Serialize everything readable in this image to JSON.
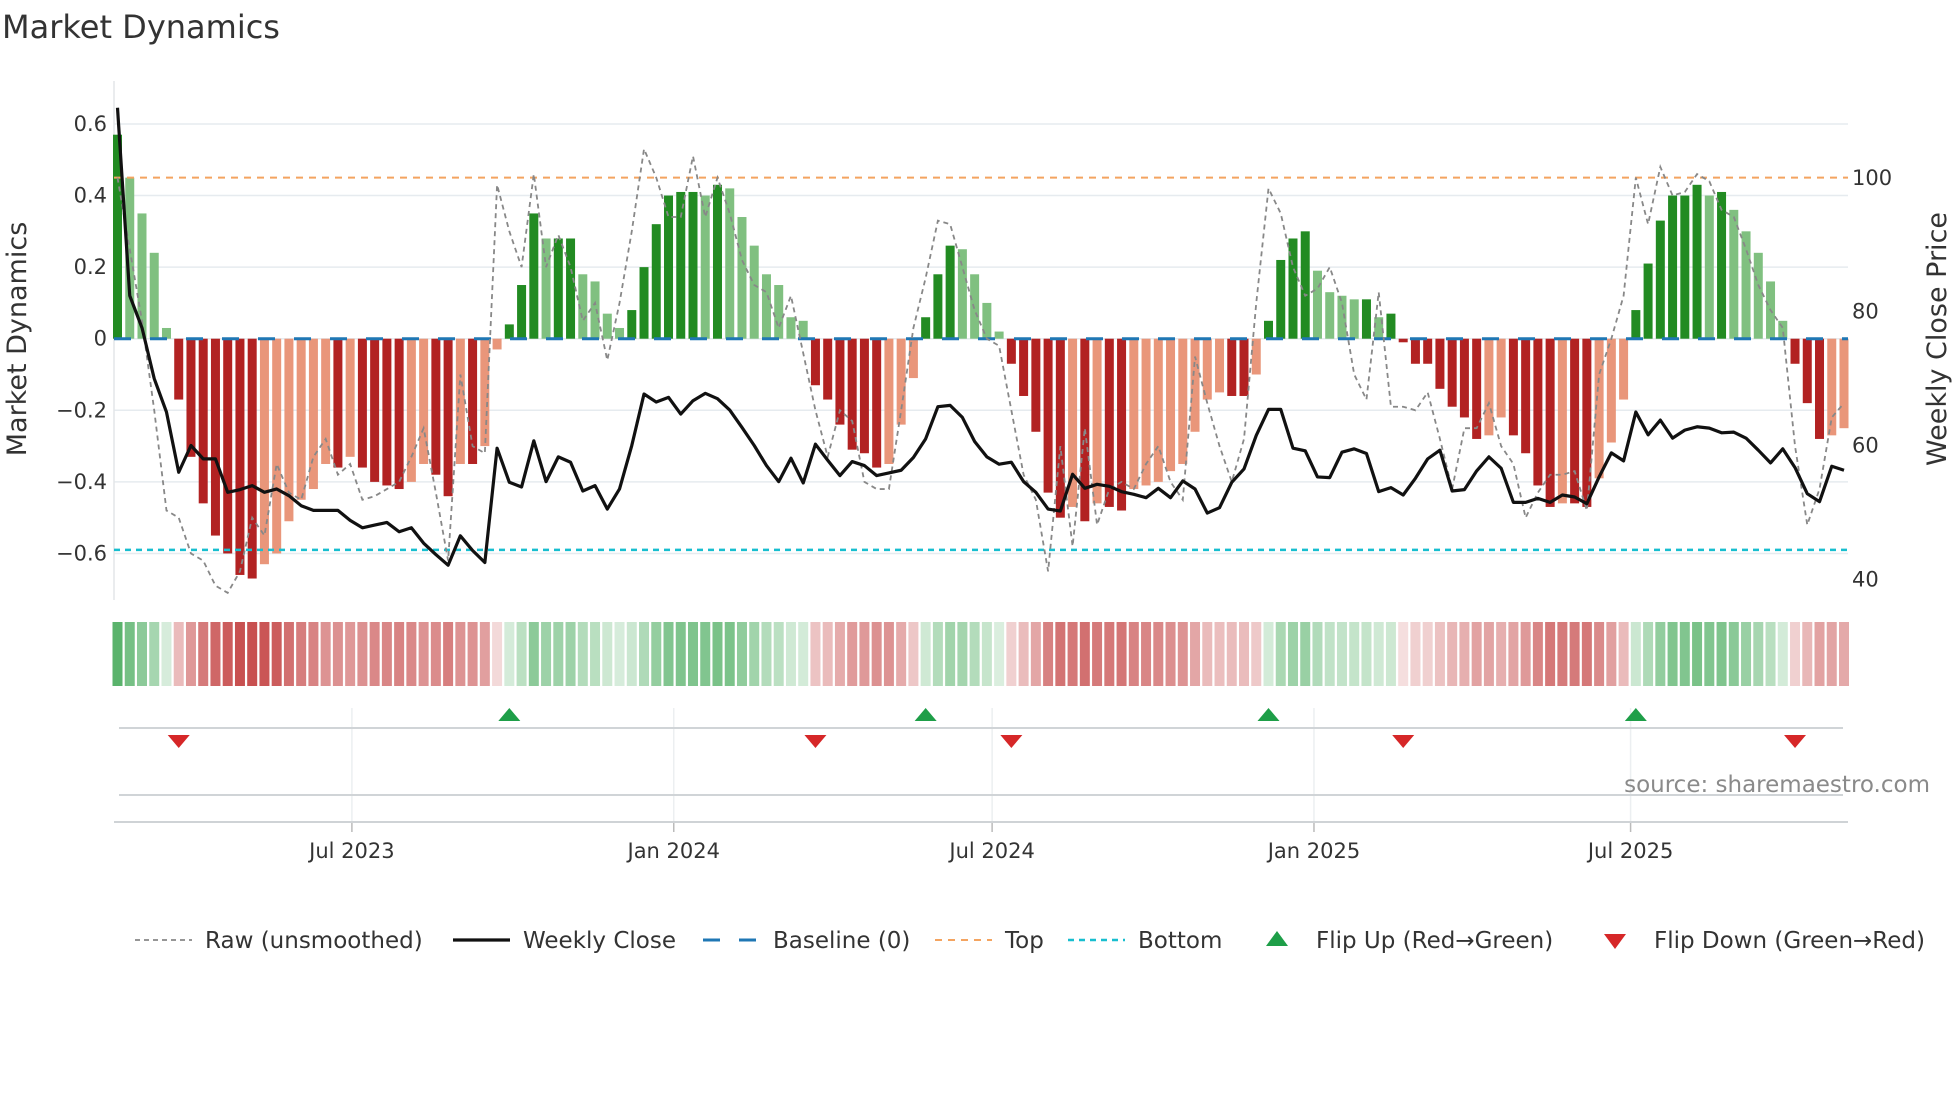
{
  "title": "Market Dynamics",
  "source": "source: sharemaestro.com",
  "chart_data": {
    "type": "bar",
    "title": "Market Dynamics",
    "ylabel": "Market Dynamics",
    "y2label": "Weekly Close Price",
    "ylim": [
      -0.73,
      0.72
    ],
    "y2lim": [
      36.9,
      114.5
    ],
    "start_date": "2023-02-17",
    "frequency": "weekly",
    "yticks": [
      {
        "v": 0.6,
        "label": "0.6"
      },
      {
        "v": 0.4,
        "label": "0.4"
      },
      {
        "v": 0.2,
        "label": "0.2"
      },
      {
        "v": 0,
        "label": "0"
      },
      {
        "v": -0.2,
        "label": "−0.2"
      },
      {
        "v": -0.4,
        "label": "−0.4"
      },
      {
        "v": -0.6,
        "label": "−0.6"
      }
    ],
    "y2ticks": [
      {
        "v": 100,
        "label": "100"
      },
      {
        "v": 80,
        "label": "80"
      },
      {
        "v": 60,
        "label": "60"
      },
      {
        "v": 40,
        "label": "40"
      }
    ],
    "xticks": [
      {
        "date": "2023-07-01",
        "label": "Jul 2023"
      },
      {
        "date": "2024-01-01",
        "label": "Jan 2024"
      },
      {
        "date": "2024-07-01",
        "label": "Jul 2024"
      },
      {
        "date": "2025-01-01",
        "label": "Jan 2025"
      },
      {
        "date": "2025-07-01",
        "label": "Jul 2025"
      }
    ],
    "top_level": 0.45,
    "bottom_level": -0.59,
    "baseline": 0,
    "smoothed": [
      0.57,
      0.45,
      0.35,
      0.24,
      0.03,
      -0.17,
      -0.33,
      -0.46,
      -0.55,
      -0.6,
      -0.66,
      -0.67,
      -0.63,
      -0.6,
      -0.51,
      -0.45,
      -0.42,
      -0.35,
      -0.36,
      -0.33,
      -0.36,
      -0.4,
      -0.41,
      -0.42,
      -0.4,
      -0.35,
      -0.38,
      -0.44,
      -0.35,
      -0.35,
      -0.3,
      -0.03,
      0.04,
      0.15,
      0.35,
      0.28,
      0.28,
      0.28,
      0.18,
      0.16,
      0.07,
      0.03,
      0.08,
      0.2,
      0.32,
      0.4,
      0.41,
      0.41,
      0.4,
      0.43,
      0.42,
      0.34,
      0.26,
      0.18,
      0.15,
      0.06,
      0.05,
      -0.13,
      -0.17,
      -0.24,
      -0.31,
      -0.32,
      -0.36,
      -0.35,
      -0.24,
      -0.11,
      0.06,
      0.18,
      0.26,
      0.25,
      0.18,
      0.1,
      0.02,
      -0.07,
      -0.16,
      -0.26,
      -0.43,
      -0.5,
      -0.47,
      -0.51,
      -0.46,
      -0.47,
      -0.48,
      -0.42,
      -0.41,
      -0.4,
      -0.37,
      -0.35,
      -0.26,
      -0.17,
      -0.15,
      -0.16,
      -0.16,
      -0.1,
      0.05,
      0.22,
      0.28,
      0.3,
      0.19,
      0.13,
      0.12,
      0.11,
      0.11,
      0.06,
      0.07,
      -0.01,
      -0.07,
      -0.07,
      -0.14,
      -0.19,
      -0.22,
      -0.28,
      -0.27,
      -0.22,
      -0.27,
      -0.32,
      -0.41,
      -0.47,
      -0.46,
      -0.46,
      -0.47,
      -0.39,
      -0.29,
      -0.17,
      0.08,
      0.21,
      0.33,
      0.4,
      0.4,
      0.43,
      0.4,
      0.41,
      0.36,
      0.3,
      0.24,
      0.16,
      0.05,
      -0.07,
      -0.18,
      -0.28,
      -0.27,
      -0.25
    ],
    "raw": [
      0.45,
      0.25,
      0.05,
      -0.2,
      -0.48,
      -0.5,
      -0.6,
      -0.62,
      -0.69,
      -0.71,
      -0.65,
      -0.5,
      -0.55,
      -0.35,
      -0.43,
      -0.45,
      -0.33,
      -0.28,
      -0.38,
      -0.35,
      -0.45,
      -0.44,
      -0.42,
      -0.4,
      -0.33,
      -0.25,
      -0.43,
      -0.62,
      -0.1,
      -0.3,
      -0.32,
      0.43,
      0.3,
      0.2,
      0.46,
      0.2,
      0.29,
      0.2,
      0.05,
      0.1,
      -0.06,
      0.1,
      0.3,
      0.53,
      0.45,
      0.34,
      0.34,
      0.51,
      0.34,
      0.45,
      0.35,
      0.22,
      0.15,
      0.13,
      0.03,
      0.12,
      -0.04,
      -0.2,
      -0.33,
      -0.2,
      -0.23,
      -0.4,
      -0.42,
      -0.42,
      -0.2,
      0.03,
      0.17,
      0.33,
      0.32,
      0.2,
      0.08,
      0.0,
      -0.02,
      -0.2,
      -0.38,
      -0.45,
      -0.65,
      -0.3,
      -0.58,
      -0.25,
      -0.52,
      -0.42,
      -0.4,
      -0.42,
      -0.35,
      -0.3,
      -0.4,
      -0.45,
      -0.05,
      -0.18,
      -0.3,
      -0.4,
      -0.28,
      0.1,
      0.42,
      0.35,
      0.2,
      0.12,
      0.14,
      0.2,
      0.1,
      -0.1,
      -0.17,
      0.13,
      -0.19,
      -0.19,
      -0.2,
      -0.15,
      -0.28,
      -0.42,
      -0.25,
      -0.25,
      -0.18,
      -0.3,
      -0.35,
      -0.5,
      -0.43,
      -0.38,
      -0.38,
      -0.37,
      -0.48,
      -0.1,
      0.0,
      0.12,
      0.45,
      0.32,
      0.48,
      0.4,
      0.41,
      0.46,
      0.44,
      0.36,
      0.34,
      0.25,
      0.15,
      0.08,
      0.03,
      -0.3,
      -0.52,
      -0.42,
      -0.22,
      -0.18
    ],
    "weekly_close": [
      110.5,
      82.4,
      77.6,
      70,
      65,
      56,
      60,
      58,
      58,
      53,
      53.4,
      54,
      53,
      53.5,
      52.5,
      51,
      50.3,
      50.3,
      50.3,
      48.8,
      47.7,
      48.1,
      48.5,
      47.1,
      47.7,
      45.4,
      43.7,
      42.1,
      46.5,
      44.3,
      42.5,
      59.6,
      54.5,
      53.8,
      60.7,
      54.6,
      58.3,
      57.5,
      53.2,
      54,
      50.5,
      53.5,
      60,
      67.7,
      66.5,
      67.2,
      64.7,
      66.7,
      67.8,
      67,
      65.3,
      62.7,
      60,
      57,
      54.6,
      58.1,
      54.4,
      60.2,
      57.8,
      55.5,
      57.6,
      57,
      55.5,
      55.9,
      56.3,
      58.2,
      61,
      65.8,
      66,
      64.2,
      60.6,
      58.3,
      57.2,
      57.5,
      54.6,
      53,
      50.5,
      50.2,
      55.7,
      53.6,
      54.2,
      53.9,
      53.1,
      52.7,
      52.2,
      53.6,
      52.2,
      54.7,
      53.5,
      49.9,
      50.7,
      54.5,
      56.5,
      61.5,
      65.4,
      65.4,
      59.6,
      59.2,
      55.3,
      55.2,
      59,
      59.5,
      58.8,
      53.1,
      53.7,
      52.6,
      55.1,
      58,
      59.3,
      53.2,
      53.4,
      56.2,
      58.3,
      56.6,
      51.5,
      51.5,
      52.1,
      51.5,
      52.6,
      52.3,
      51.3,
      55.3,
      58.9,
      57.7,
      65,
      61.6,
      63.8,
      61.1,
      62.3,
      62.8,
      62.6,
      61.9,
      62,
      61.1,
      59.3,
      57.4,
      59.5,
      56.7,
      52.8,
      51.6,
      56.9,
      56.3
    ],
    "legend": {
      "placement": "bottom",
      "items": [
        {
          "key": "raw",
          "label": "Raw (unsmoothed)"
        },
        {
          "key": "close",
          "label": "Weekly Close"
        },
        {
          "key": "baseline",
          "label": "Baseline (0)"
        },
        {
          "key": "top",
          "label": "Top"
        },
        {
          "key": "bottom",
          "label": "Bottom"
        },
        {
          "key": "flip_up",
          "label": "Flip Up (Red→Green)"
        },
        {
          "key": "flip_down",
          "label": "Flip Down (Green→Red)"
        }
      ]
    },
    "colors": {
      "green_strong": "#228b22",
      "green_weak": "#80c080",
      "red_strong": "#b22222",
      "red_weak": "#e9967a",
      "close": "#111111",
      "raw": "#888888",
      "baseline": "#1f77b4",
      "top": "#f4a460",
      "bottom": "#17becf",
      "flip_up": "#1e9e48",
      "flip_down": "#d62728"
    }
  }
}
